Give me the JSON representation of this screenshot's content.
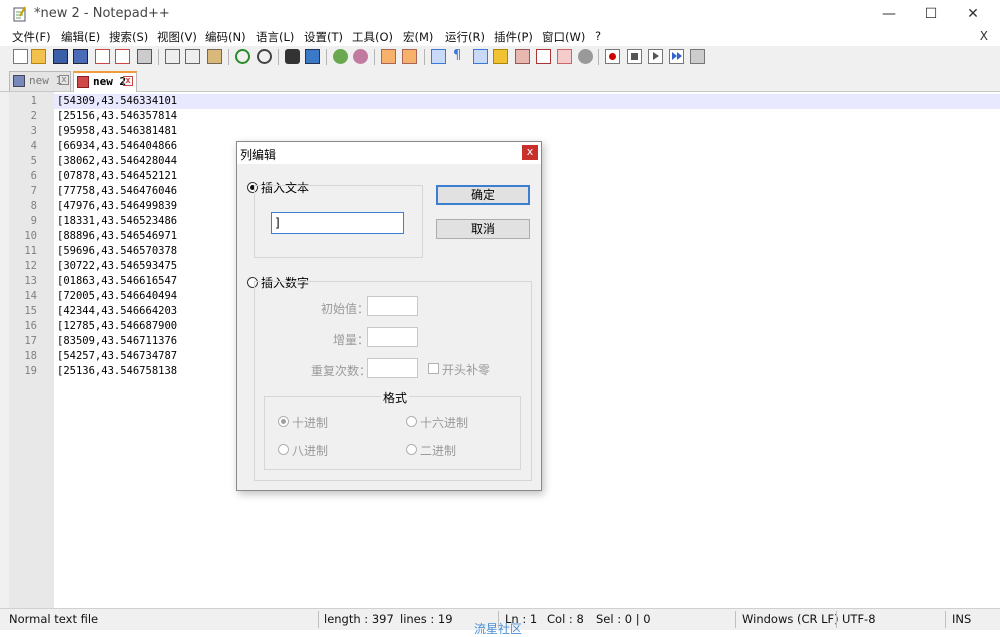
{
  "window": {
    "title": "*new 2 - Notepad++",
    "minimize": "—",
    "maximize": "☐",
    "close": "✕"
  },
  "menu": {
    "items": [
      "文件(F)",
      "编辑(E)",
      "搜索(S)",
      "视图(V)",
      "编码(N)",
      "语言(L)",
      "设置(T)",
      "工具(O)",
      "宏(M)",
      "运行(R)",
      "插件(P)",
      "窗口(W)",
      "?"
    ],
    "close": "X"
  },
  "toolbar": {
    "icons": [
      "new-file-icon",
      "open-file-icon",
      "save-icon",
      "save-all-icon",
      "close-icon",
      "close-all-icon",
      "print-icon",
      "cut-icon",
      "copy-icon",
      "paste-icon",
      "undo-icon",
      "redo-icon",
      "find-icon",
      "replace-icon",
      "zoom-in-icon",
      "zoom-out-icon",
      "sync-vertical-icon",
      "sync-horizontal-icon",
      "word-wrap-icon",
      "show-all-chars-icon",
      "indent-guide-icon",
      "udl-icon",
      "doc-map-icon",
      "function-list-icon",
      "folder-workspace-icon",
      "monitor-icon",
      "record-macro-icon",
      "stop-record-icon",
      "play-macro-icon",
      "run-macro-multiple-icon",
      "save-macro-icon"
    ]
  },
  "tabs": [
    {
      "label": "new 1",
      "active": false,
      "close": "x"
    },
    {
      "label": "new 2",
      "active": true,
      "close": "x"
    }
  ],
  "editor": {
    "line_numbers": [
      "1",
      "2",
      "3",
      "4",
      "5",
      "6",
      "7",
      "8",
      "9",
      "10",
      "11",
      "12",
      "13",
      "14",
      "15",
      "16",
      "17",
      "18",
      "19"
    ],
    "lines": [
      "[54309,43.546334101",
      "[25156,43.546357814",
      "[95958,43.546381481",
      "[66934,43.546404866",
      "[38062,43.546428044",
      "[07878,43.546452121",
      "[77758,43.546476046",
      "[47976,43.546499839",
      "[18331,43.546523486",
      "[88896,43.546546971",
      "[59696,43.546570378",
      "[30722,43.546593475",
      "[01863,43.546616547",
      "[72005,43.546640494",
      "[42344,43.546664203",
      "[12785,43.546687900",
      "[83509,43.546711376",
      "[54257,43.546734787",
      "[25136,43.546758138"
    ]
  },
  "dialog": {
    "title": "列编辑",
    "close": "x",
    "insert_text_label": "插入文本",
    "insert_text_value": "]",
    "ok_label": "确定",
    "cancel_label": "取消",
    "insert_number_label": "插入数字",
    "initial_label": "初始值：",
    "increment_label": "增量：",
    "repeat_label": "重复次数：",
    "leading_zero_label": "开头补零",
    "format_label": "格式",
    "dec_label": "十进制",
    "hex_label": "十六进制",
    "oct_label": "八进制",
    "bin_label": "二进制"
  },
  "status": {
    "file_type": "Normal text file",
    "length": "length : 397",
    "lines": "lines : 19",
    "ln": "Ln : 1",
    "col": "Col : 8",
    "sel": "Sel : 0 | 0",
    "eol": "Windows (CR LF)",
    "encoding": "UTF-8",
    "mode": "INS"
  },
  "watermark": "流星社区",
  "colors": {
    "current_line": "#e8e8ff",
    "gutter": "#e8e8e8",
    "dialog_close": "#c8302c",
    "focus_border": "#3c7fd1"
  }
}
